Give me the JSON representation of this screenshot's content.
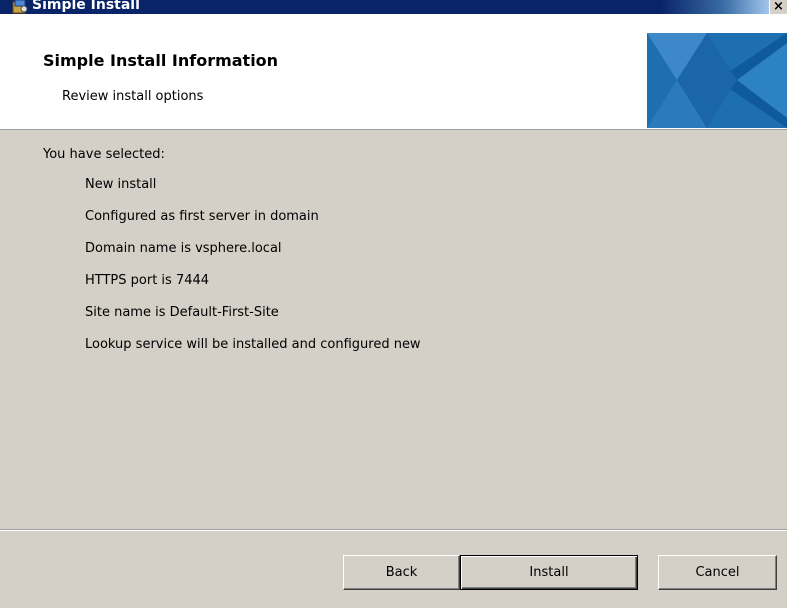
{
  "window": {
    "title": "Simple Install",
    "close_glyph": "×",
    "app_icon": "installer-icon"
  },
  "header": {
    "title": "Simple Install Information",
    "subtitle": "Review install options"
  },
  "content": {
    "heading": "You have selected:",
    "items": [
      "New install",
      "Configured as first server in domain",
      "Domain name is vsphere.local",
      "HTTPS port is 7444",
      "Site name is Default-First-Site",
      "Lookup service will be installed and configured new"
    ]
  },
  "buttons": {
    "back": "Back",
    "install": "Install",
    "cancel": "Cancel"
  },
  "colors": {
    "titlebar": "#0a246a",
    "dialog_face": "#d4d0c8",
    "banner_accent": "#1f6fb2"
  }
}
